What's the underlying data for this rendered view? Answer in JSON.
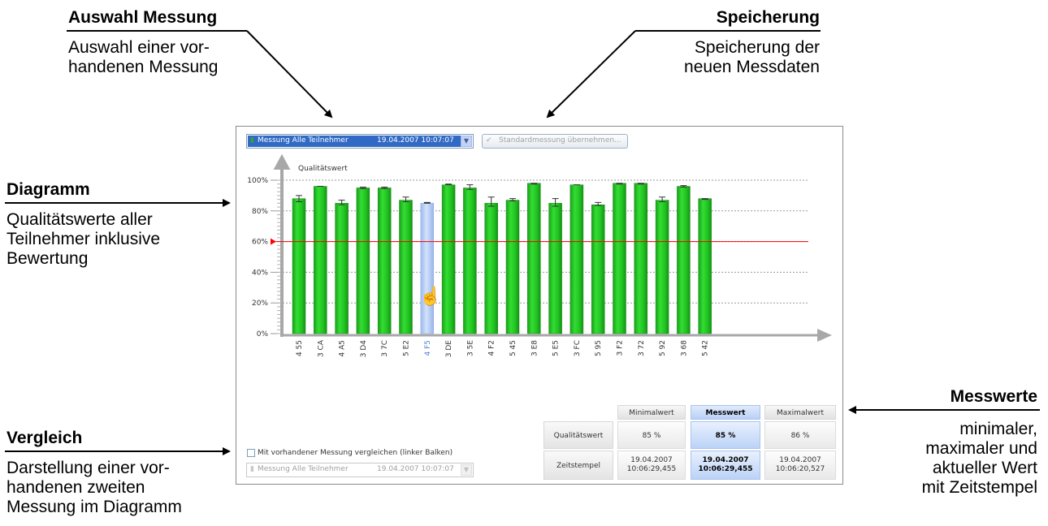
{
  "annotations": {
    "auswahl": {
      "heading": "Auswahl Messung",
      "line1": "Auswahl einer vor-",
      "line2": "handenen Messung"
    },
    "speicherung": {
      "heading": "Speicherung",
      "line1": "Speicherung der",
      "line2": "neuen Messdaten"
    },
    "diagramm": {
      "heading": "Diagramm",
      "line1": "Qualitätswerte aller",
      "line2": "Teilnehmer inklusive",
      "line3": "Bewertung"
    },
    "vergleich": {
      "heading": "Vergleich",
      "line1": "Darstellung einer vor-",
      "line2": "handenen zweiten",
      "line3": "Messung im Diagramm"
    },
    "messwerte": {
      "heading": "Messwerte",
      "line1": "minimaler,",
      "line2": "maximaler und",
      "line3": "aktueller Wert",
      "line4": "mit Zeitstempel"
    }
  },
  "toolbar": {
    "measurement_select": {
      "name": "Messung Alle Teilnehmer",
      "timestamp": "19.04.2007  10:07:07"
    },
    "apply_button": "Standardmessung übernehmen..."
  },
  "chart_data": {
    "type": "bar",
    "ylabel": "Qualitätswert",
    "yticks": [
      "0%",
      "20%",
      "40%",
      "60%",
      "80%",
      "100%"
    ],
    "ylim": [
      0,
      100
    ],
    "threshold": 60,
    "threshold_color": "#ff0000",
    "bar_color": "#22cc22",
    "selected_color": "#b0c8f4",
    "selected_index": 6,
    "categories": [
      "4 55",
      "3 CA",
      "4 A5",
      "3 D4",
      "3 7C",
      "5 E2",
      "4 F5",
      "3 DE",
      "3 5E",
      "4 F2",
      "5 45",
      "3 E8",
      "5 E5",
      "3 FC",
      "5 95",
      "3 F2",
      "3 72",
      "5 92",
      "3 68",
      "5 42"
    ],
    "values": [
      88,
      96,
      85,
      95,
      95,
      87,
      85,
      97,
      95,
      85,
      87,
      98,
      85,
      97,
      84,
      98,
      98,
      87,
      96,
      88
    ],
    "err_low": [
      86,
      96,
      84,
      94.5,
      94.5,
      86,
      85,
      97,
      94,
      83,
      86.5,
      97.5,
      83,
      97,
      83.5,
      97.5,
      97.5,
      86,
      95.5,
      87.5
    ],
    "err_high": [
      90,
      96,
      87,
      95.5,
      95.5,
      89,
      85.5,
      97.5,
      97,
      89,
      88,
      98,
      88,
      97,
      85.5,
      98,
      98,
      89,
      96.5,
      88
    ],
    "grid": true
  },
  "messwerte_table": {
    "headers": [
      "Minimalwert",
      "Messwert",
      "Maximalwert"
    ],
    "rows": [
      {
        "label": "Qualitätswert",
        "min": "85 %",
        "value": "85 %",
        "max": "86 %"
      },
      {
        "label": "Zeitstempel",
        "min_date": "19.04.2007",
        "min_time": "10:06:29,455",
        "value_date": "19.04.2007",
        "value_time": "10:06:29,455",
        "max_date": "19.04.2007",
        "max_time": "10:06:20,527"
      }
    ]
  },
  "compare": {
    "checkbox_label": "Mit vorhandener Messung vergleichen (linker Balken)",
    "checked": false,
    "select": {
      "name": "Messung Alle Teilnehmer",
      "timestamp": "19.04.2007  10:07:07"
    }
  }
}
